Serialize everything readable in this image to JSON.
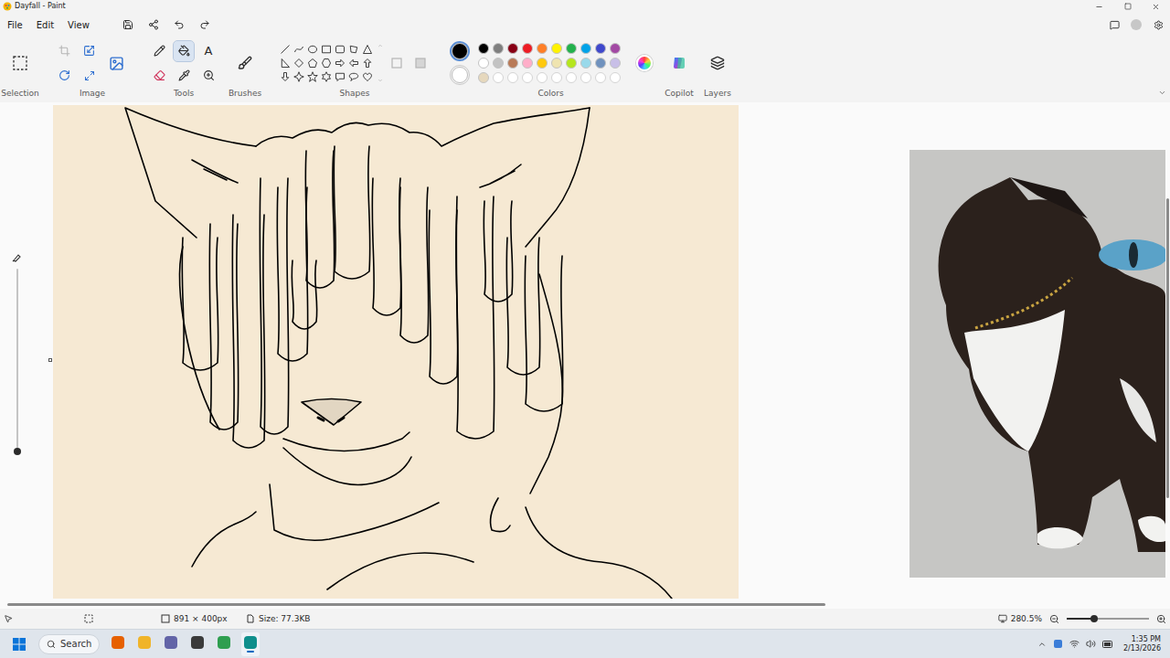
{
  "window": {
    "title": "Dayfall - Paint"
  },
  "menu": [
    {
      "label": "File"
    },
    {
      "label": "Edit"
    },
    {
      "label": "View"
    }
  ],
  "ribbon": {
    "groups": [
      {
        "label": "Selection"
      },
      {
        "label": "Image"
      },
      {
        "label": "Tools"
      },
      {
        "label": "Brushes"
      },
      {
        "label": "Shapes"
      },
      {
        "label": "Colors"
      },
      {
        "label": "Copilot"
      },
      {
        "label": "Layers"
      }
    ]
  },
  "tools": [
    {
      "kind": "pencil",
      "selected": false
    },
    {
      "kind": "fill",
      "selected": true
    },
    {
      "kind": "text",
      "label": "A",
      "selected": false
    },
    {
      "kind": "eraser",
      "selected": false
    },
    {
      "kind": "picker",
      "selected": false
    },
    {
      "kind": "magnifier",
      "selected": false
    }
  ],
  "brush_size": {
    "level": 0.0
  },
  "colors": {
    "primary": {
      "color": "#000000",
      "selected": true
    },
    "secondary": {
      "color": "#ffffff",
      "selected": false
    },
    "palette": [
      {
        "color": "#000000",
        "kind": "swatch"
      },
      {
        "color": "#7f7f7f",
        "kind": "swatch"
      },
      {
        "color": "#880015",
        "kind": "swatch"
      },
      {
        "color": "#ed1c24",
        "kind": "swatch"
      },
      {
        "color": "#ff7f27",
        "kind": "swatch"
      },
      {
        "color": "#fff200",
        "kind": "swatch"
      },
      {
        "color": "#22b14c",
        "kind": "swatch"
      },
      {
        "color": "#00a2e8",
        "kind": "swatch"
      },
      {
        "color": "#3f48cc",
        "kind": "swatch"
      },
      {
        "color": "#a349a4",
        "kind": "swatch"
      },
      {
        "color": "#ffffff",
        "kind": "swatch"
      },
      {
        "color": "#c3c3c3",
        "kind": "swatch"
      },
      {
        "color": "#b97a57",
        "kind": "swatch"
      },
      {
        "color": "#ffaec9",
        "kind": "swatch"
      },
      {
        "color": "#ffc90e",
        "kind": "swatch"
      },
      {
        "color": "#efe4b0",
        "kind": "swatch"
      },
      {
        "color": "#b5e61d",
        "kind": "swatch"
      },
      {
        "color": "#99d9ea",
        "kind": "swatch"
      },
      {
        "color": "#7092be",
        "kind": "swatch"
      },
      {
        "color": "#c8bfe7",
        "kind": "swatch"
      },
      {
        "color": "#e6d8bd",
        "kind": "swatch"
      },
      {
        "color": "#ffffff",
        "kind": "empty"
      },
      {
        "color": "#ffffff",
        "kind": "empty"
      },
      {
        "color": "#ffffff",
        "kind": "empty"
      },
      {
        "color": "#ffffff",
        "kind": "empty"
      },
      {
        "color": "#ffffff",
        "kind": "empty"
      },
      {
        "color": "#ffffff",
        "kind": "empty"
      },
      {
        "color": "#ffffff",
        "kind": "empty"
      },
      {
        "color": "#ffffff",
        "kind": "empty"
      },
      {
        "color": "#ffffff",
        "kind": "empty"
      }
    ]
  },
  "scrollbars": {
    "horizontal": {
      "level": 0.71
    },
    "vertical": {
      "level": 0.6
    }
  },
  "status_bar": {
    "dimensions": "891 × 400px",
    "file_size": "Size: 77.3KB",
    "zoom": "280.5%",
    "zoom_level": 0.33
  },
  "taskbar": {
    "search": "Search",
    "time": "1:35 PM",
    "date": "2/13/2026",
    "apps": [
      {
        "color": "#e66000",
        "active": false
      },
      {
        "color": "#f0b429",
        "active": false
      },
      {
        "color": "#6264a7",
        "active": false
      },
      {
        "color": "#3a3a3a",
        "active": false
      },
      {
        "color": "#2e9e4f",
        "active": false
      },
      {
        "color": "#0f8f8c",
        "active": true
      }
    ]
  }
}
